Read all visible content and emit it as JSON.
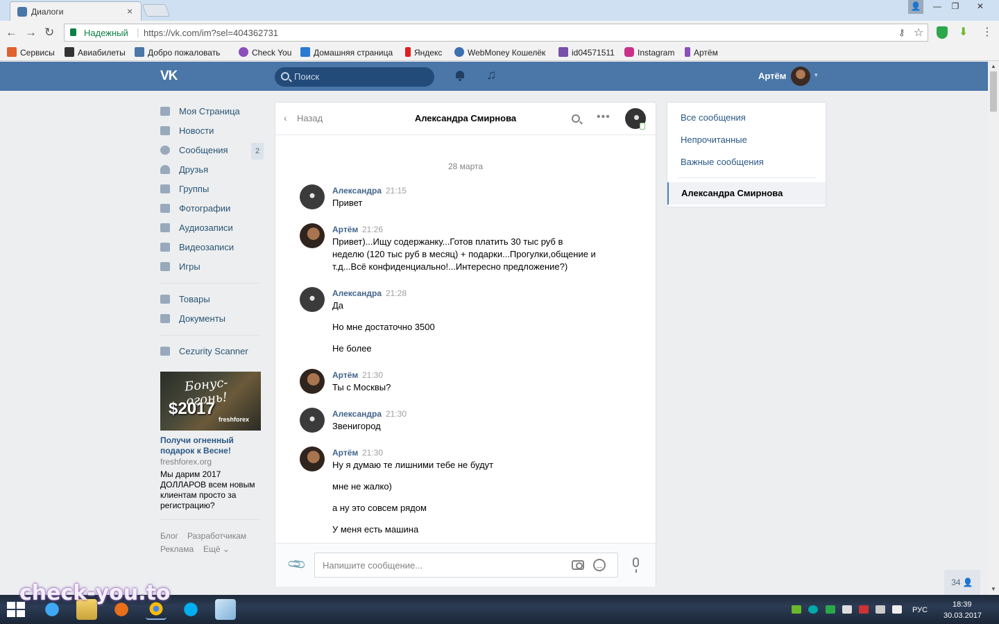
{
  "browser": {
    "tab_title": "Диалоги",
    "tab_close": "×",
    "secure_label": "Надежный",
    "url": "https://vk.com/im?sel=404362731",
    "window_buttons": {
      "minimize": "—",
      "maximize": "❐",
      "close": "✕",
      "profile": "👤"
    }
  },
  "bookmarks": [
    {
      "label": "Сервисы",
      "color": "#e06030"
    },
    {
      "label": "Авиабилеты",
      "color": "#222222"
    },
    {
      "label": "Добро пожаловать",
      "color": "#4a76a8"
    },
    {
      "label": "Check You",
      "color": "#8a4fb8"
    },
    {
      "label": "Домашняя страница",
      "color": "#2a7ad6"
    },
    {
      "label": "Яндекс",
      "color": "#e02020"
    },
    {
      "label": "WebMoney Кошелёк",
      "color": "#3a6fb0"
    },
    {
      "label": "id04571511",
      "color": "#7a4fa8"
    },
    {
      "label": "Instagram",
      "color": "#c8308a"
    },
    {
      "label": "Артём",
      "color": "#8a4fb8"
    }
  ],
  "vk_header": {
    "logo": "VK",
    "search_placeholder": "Поиск",
    "user_name": "Артём",
    "caret": "▾"
  },
  "side_menu": [
    {
      "label": "Моя Страница",
      "icon": "home-icon"
    },
    {
      "label": "Новости",
      "icon": "news-icon"
    },
    {
      "label": "Сообщения",
      "icon": "messages-icon",
      "counter": "2"
    },
    {
      "label": "Друзья",
      "icon": "friends-icon"
    },
    {
      "label": "Группы",
      "icon": "groups-icon"
    },
    {
      "label": "Фотографии",
      "icon": "photos-icon"
    },
    {
      "label": "Аудиозаписи",
      "icon": "audio-icon"
    },
    {
      "label": "Видеозаписи",
      "icon": "video-icon"
    },
    {
      "label": "Игры",
      "icon": "games-icon"
    }
  ],
  "side_menu_2": [
    {
      "label": "Товары",
      "icon": "goods-icon"
    },
    {
      "label": "Документы",
      "icon": "docs-icon"
    }
  ],
  "side_menu_3": [
    {
      "label": "Cezurity Scanner",
      "icon": "app-icon"
    }
  ],
  "ad": {
    "image_text_1": "Бонус-огонь!",
    "image_text_2": "$2017",
    "image_text_3": "freshforex",
    "title": "Получи огненный подарок к Весне!",
    "domain": "freshforex.org",
    "text": "Мы дарим 2017 ДОЛЛАРОВ всем новым клиентам просто за регистрацию?"
  },
  "footer_links": {
    "blog": "Блог",
    "developers": "Разработчикам",
    "ads": "Реклама",
    "more": "Ещё ⌄"
  },
  "chat": {
    "back_label": "Назад",
    "back_chevron": "‹",
    "title": "Александра Смирнова",
    "more": "•••",
    "date_separator": "28 марта",
    "messages": [
      {
        "author": "Александра",
        "time": "21:15",
        "lines": [
          "Привет"
        ]
      },
      {
        "author": "Артём",
        "time": "21:26",
        "lines": [
          "Привет)...Ищу содержанку...Готов платить 30 тыс руб в",
          "неделю (120 тыс руб в месяц) + подарки...Прогулки,общение и",
          "т.д...Всё конфиденциально!...Интересно предложение?)"
        ]
      },
      {
        "author": "Александра",
        "time": "21:28",
        "lines": [
          "Да",
          "Но мне достаточно 3500",
          "Не более"
        ]
      },
      {
        "author": "Артём",
        "time": "21:30",
        "lines": [
          "Ты с Москвы?"
        ]
      },
      {
        "author": "Александра",
        "time": "21:30",
        "lines": [
          "Звенигород"
        ]
      },
      {
        "author": "Артём",
        "time": "21:30",
        "lines": [
          "Ну я думаю те лишними тебе не будут",
          "мне не жалко)",
          "а ну это совсем рядом",
          "У меня есть машина"
        ]
      }
    ],
    "input_placeholder": "Напишите сообщение..."
  },
  "filters": {
    "items": [
      "Все сообщения",
      "Непрочитанные",
      "Важные сообщения"
    ],
    "active": "Александра Смирнова"
  },
  "online_counter": "34 👤",
  "taskbar": {
    "lang": "РУС",
    "time": "18:39",
    "date": "30.03.2017"
  },
  "watermark": "check-you.to"
}
